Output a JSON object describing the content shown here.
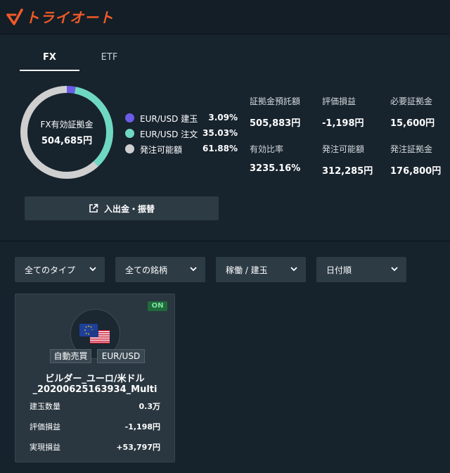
{
  "app": {
    "logo_text": "トライオート",
    "brand_color": "#f05a28"
  },
  "tabs": [
    {
      "label": "FX",
      "active": true
    },
    {
      "label": "ETF",
      "active": false
    }
  ],
  "summary": {
    "donut_label": "FX有効証拠金",
    "donut_value": "504,685円",
    "legend": [
      {
        "label": "EUR/USD 建玉",
        "pct": "3.09%",
        "color": "#6c5ce7",
        "fraction": 0.0309
      },
      {
        "label": "EUR/USD 注文",
        "pct": "35.03%",
        "color": "#6fd8c3",
        "fraction": 0.3503
      },
      {
        "label": "発注可能額",
        "pct": "61.88%",
        "color": "#cfcfcf",
        "fraction": 0.6188
      }
    ],
    "stats": [
      {
        "label": "証拠金預託額",
        "value": "505,883円"
      },
      {
        "label": "評価損益",
        "value": "-1,198円"
      },
      {
        "label": "必要証拠金",
        "value": "15,600円"
      },
      {
        "label": "有効比率",
        "value": "3235.16%"
      },
      {
        "label": "発注可能額",
        "value": "312,285円"
      },
      {
        "label": "発注証拠金",
        "value": "176,800円"
      }
    ],
    "transfer_button": "入出金・振替"
  },
  "filters": [
    {
      "label": "全てのタイプ"
    },
    {
      "label": "全ての銘柄"
    },
    {
      "label": "稼働 / 建玉"
    },
    {
      "label": "日付順"
    }
  ],
  "card": {
    "status": "ON",
    "tag_type": "自動売買",
    "tag_pair": "EUR/USD",
    "name_line1": "ビルダー_ユーロ/米ドル",
    "name_line2": "_20200625163934_Multi",
    "rows": [
      {
        "key": "建玉数量",
        "value": "0.3万"
      },
      {
        "key": "評価損益",
        "value": "-1,198円"
      },
      {
        "key": "実現損益",
        "value": "+53,797円"
      }
    ]
  }
}
